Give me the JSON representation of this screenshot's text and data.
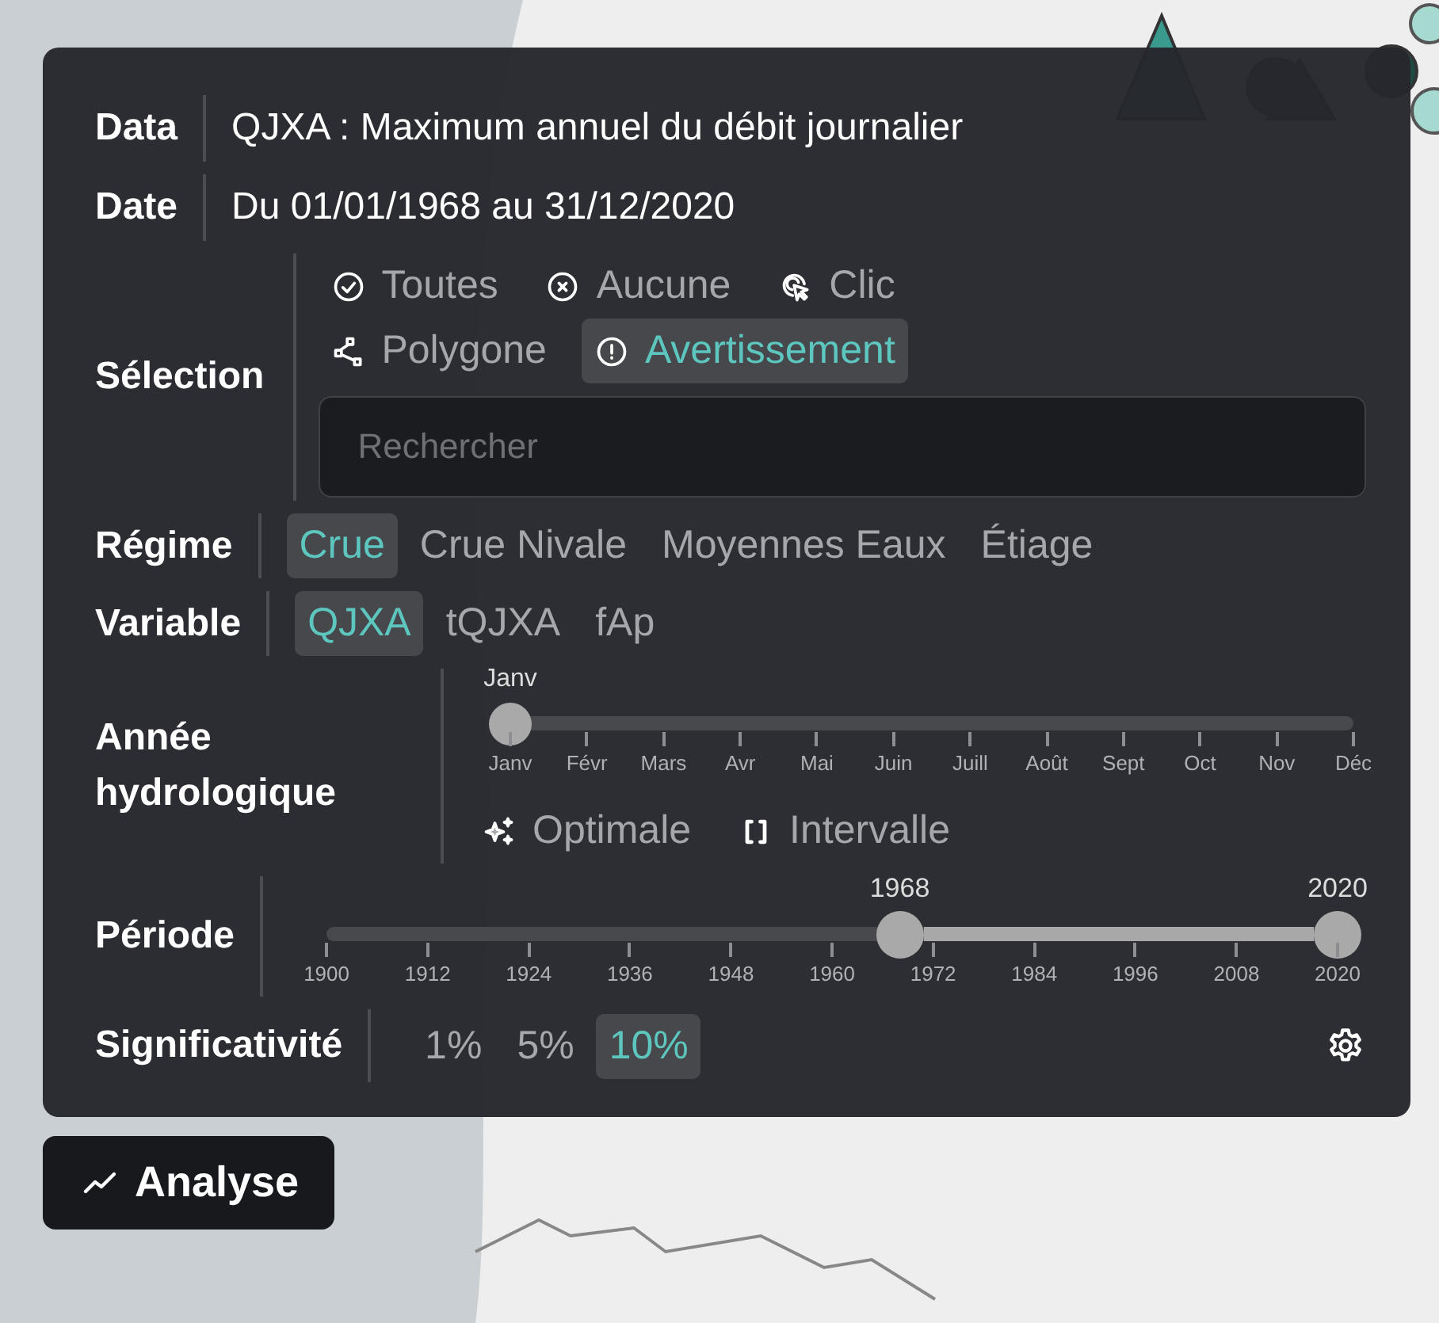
{
  "panel": {
    "info": [
      {
        "label": "Data",
        "value": "QJXA : Maximum annuel du débit journalier"
      },
      {
        "label": "Date",
        "value": "Du 01/01/1968 au 31/12/2020"
      }
    ],
    "selection": {
      "label": "Sélection",
      "options": [
        {
          "label": "Toutes",
          "kind": "all",
          "selected": false
        },
        {
          "label": "Aucune",
          "kind": "none",
          "selected": false
        },
        {
          "label": "Clic",
          "kind": "click",
          "selected": false
        },
        {
          "label": "Polygone",
          "kind": "polygon",
          "selected": false
        },
        {
          "label": "Avertissement",
          "kind": "warning",
          "selected": true
        }
      ],
      "search": {
        "placeholder": "Rechercher"
      }
    },
    "regime": {
      "label": "Régime",
      "options": [
        {
          "label": "Crue",
          "selected": true
        },
        {
          "label": "Crue Nivale",
          "selected": false
        },
        {
          "label": "Moyennes Eaux",
          "selected": false
        },
        {
          "label": "Étiage",
          "selected": false
        }
      ]
    },
    "variable": {
      "label": "Variable",
      "options": [
        {
          "label": "QJXA",
          "selected": true
        },
        {
          "label": "tQJXA",
          "selected": false
        },
        {
          "label": "fAp",
          "selected": false
        }
      ]
    },
    "hydro_year": {
      "label": "Année hydrologique",
      "slider": {
        "value_label": "Janv",
        "level": 0,
        "ticks": [
          "Janv",
          "Févr",
          "Mars",
          "Avr",
          "Mai",
          "Juin",
          "Juill",
          "Août",
          "Sept",
          "Oct",
          "Nov",
          "Déc"
        ]
      },
      "options": [
        {
          "label": "Optimale",
          "kind": "optimal",
          "selected": false
        },
        {
          "label": "Intervalle",
          "kind": "interval",
          "selected": false
        }
      ]
    },
    "period": {
      "label": "Période",
      "thumbs": [
        {
          "label": "1968",
          "level": 0.567
        },
        {
          "label": "2020",
          "level": 1
        }
      ],
      "ticks": [
        "1900",
        "1912",
        "1924",
        "1936",
        "1948",
        "1960",
        "1972",
        "1984",
        "1996",
        "2008",
        "2020"
      ]
    },
    "significance": {
      "label": "Significativité",
      "options": [
        {
          "label": "1%",
          "selected": false
        },
        {
          "label": "5%",
          "selected": false
        },
        {
          "label": "10%",
          "selected": true
        }
      ]
    }
  },
  "analyse_button": {
    "label": "Analyse"
  }
}
